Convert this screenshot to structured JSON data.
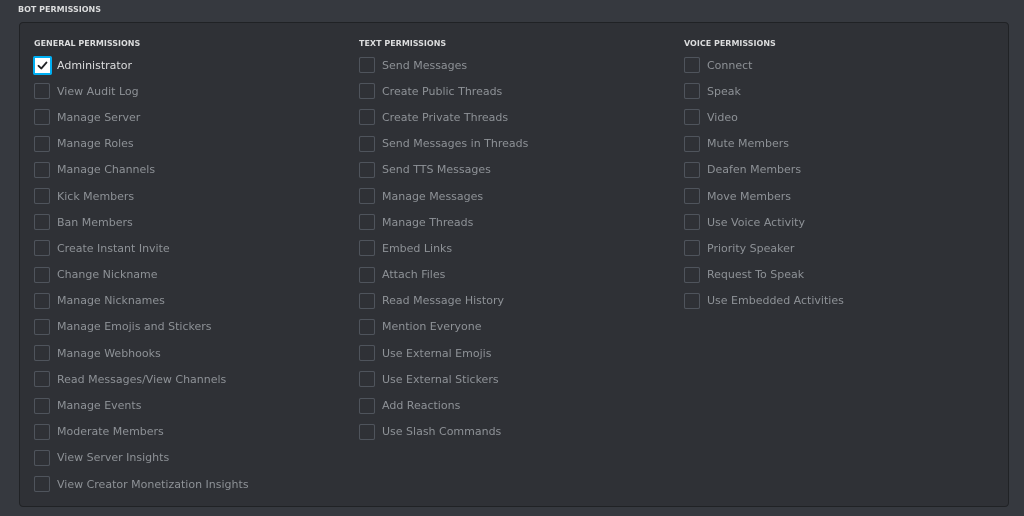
{
  "section_title": "BOT PERMISSIONS",
  "columns": {
    "general": {
      "title": "GENERAL PERMISSIONS",
      "items": [
        {
          "label": "Administrator",
          "checked": true
        },
        {
          "label": "View Audit Log",
          "checked": false
        },
        {
          "label": "Manage Server",
          "checked": false
        },
        {
          "label": "Manage Roles",
          "checked": false
        },
        {
          "label": "Manage Channels",
          "checked": false
        },
        {
          "label": "Kick Members",
          "checked": false
        },
        {
          "label": "Ban Members",
          "checked": false
        },
        {
          "label": "Create Instant Invite",
          "checked": false
        },
        {
          "label": "Change Nickname",
          "checked": false
        },
        {
          "label": "Manage Nicknames",
          "checked": false
        },
        {
          "label": "Manage Emojis and Stickers",
          "checked": false
        },
        {
          "label": "Manage Webhooks",
          "checked": false
        },
        {
          "label": "Read Messages/View Channels",
          "checked": false
        },
        {
          "label": "Manage Events",
          "checked": false
        },
        {
          "label": "Moderate Members",
          "checked": false
        },
        {
          "label": "View Server Insights",
          "checked": false
        },
        {
          "label": "View Creator Monetization Insights",
          "checked": false
        }
      ]
    },
    "text": {
      "title": "TEXT PERMISSIONS",
      "items": [
        {
          "label": "Send Messages",
          "checked": false
        },
        {
          "label": "Create Public Threads",
          "checked": false
        },
        {
          "label": "Create Private Threads",
          "checked": false
        },
        {
          "label": "Send Messages in Threads",
          "checked": false
        },
        {
          "label": "Send TTS Messages",
          "checked": false
        },
        {
          "label": "Manage Messages",
          "checked": false
        },
        {
          "label": "Manage Threads",
          "checked": false
        },
        {
          "label": "Embed Links",
          "checked": false
        },
        {
          "label": "Attach Files",
          "checked": false
        },
        {
          "label": "Read Message History",
          "checked": false
        },
        {
          "label": "Mention Everyone",
          "checked": false
        },
        {
          "label": "Use External Emojis",
          "checked": false
        },
        {
          "label": "Use External Stickers",
          "checked": false
        },
        {
          "label": "Add Reactions",
          "checked": false
        },
        {
          "label": "Use Slash Commands",
          "checked": false
        }
      ]
    },
    "voice": {
      "title": "VOICE PERMISSIONS",
      "items": [
        {
          "label": "Connect",
          "checked": false
        },
        {
          "label": "Speak",
          "checked": false
        },
        {
          "label": "Video",
          "checked": false
        },
        {
          "label": "Mute Members",
          "checked": false
        },
        {
          "label": "Deafen Members",
          "checked": false
        },
        {
          "label": "Move Members",
          "checked": false
        },
        {
          "label": "Use Voice Activity",
          "checked": false
        },
        {
          "label": "Priority Speaker",
          "checked": false
        },
        {
          "label": "Request To Speak",
          "checked": false
        },
        {
          "label": "Use Embedded Activities",
          "checked": false
        }
      ]
    }
  },
  "colors": {
    "background": "#36393f",
    "panel": "#2f3136",
    "checked_border": "#00b0f4",
    "label_active": "#dcddde",
    "label_inactive": "#8e9297"
  }
}
